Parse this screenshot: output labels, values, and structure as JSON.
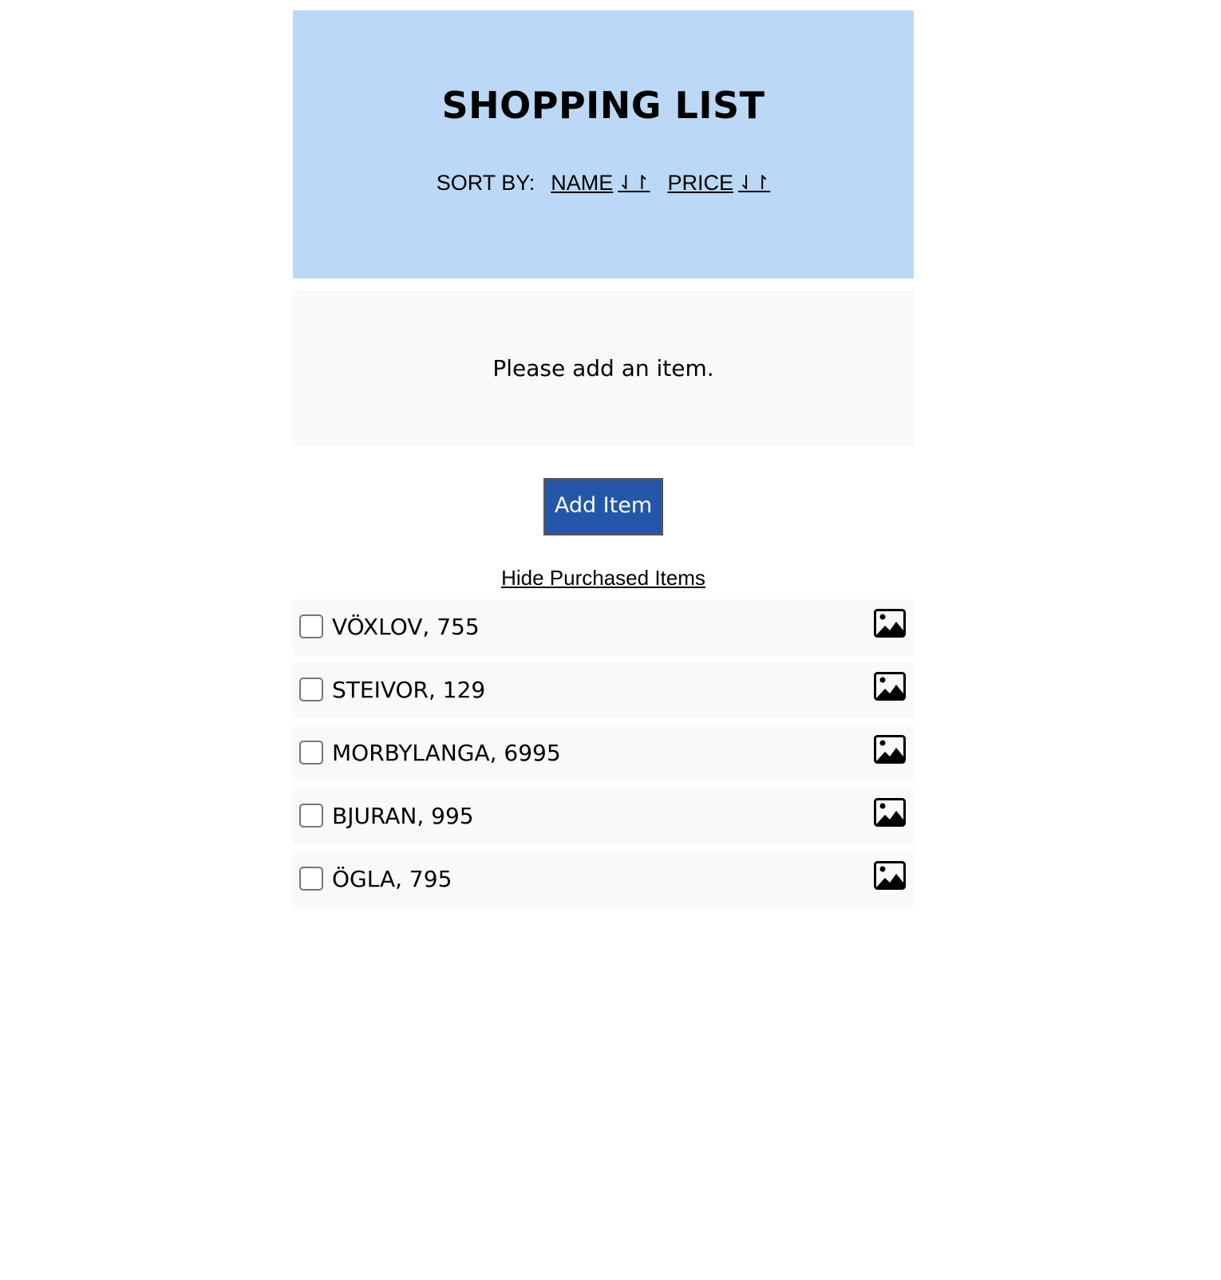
{
  "header": {
    "title": "SHOPPING LIST",
    "sort_label": "SORT BY:",
    "sort_options": [
      {
        "label": "NAME",
        "icon": "sort-arrows-icon"
      },
      {
        "label": "PRICE",
        "icon": "sort-arrows-icon"
      }
    ]
  },
  "empty_message": "Please add an item.",
  "add_button_label": "Add Item",
  "hide_purchased_label": "Hide Purchased Items",
  "items": [
    {
      "label": "VÖXLOV, 755",
      "checked": false,
      "icon": "image-icon"
    },
    {
      "label": "STEIVOR, 129",
      "checked": false,
      "icon": "image-icon"
    },
    {
      "label": "MORBYLANGA, 6995",
      "checked": false,
      "icon": "image-icon"
    },
    {
      "label": "BJURAN, 995",
      "checked": false,
      "icon": "image-icon"
    },
    {
      "label": "ÖGLA, 795",
      "checked": false,
      "icon": "image-icon"
    }
  ],
  "colors": {
    "header_bg": "#bbd8f6",
    "panel_bg": "#faf9f7",
    "button_bg": "#2456a9",
    "button_border": "#555555"
  }
}
